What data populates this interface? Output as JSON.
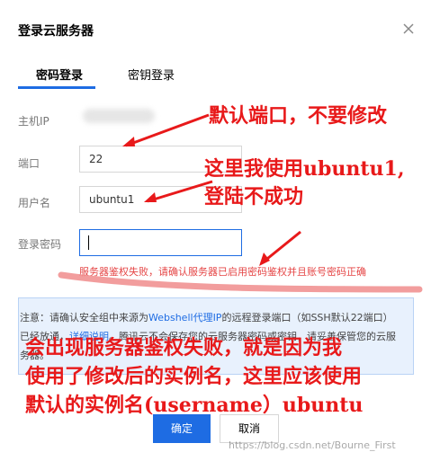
{
  "dialog": {
    "title": "登录云服务器"
  },
  "tabs": [
    {
      "label": "密码登录"
    },
    {
      "label": "密钥登录"
    }
  ],
  "form": {
    "host_label": "主机IP",
    "port_label": "端口",
    "port_value": "22",
    "user_label": "用户名",
    "user_value": "ubuntu1",
    "password_label": "登录密码",
    "password_value": ""
  },
  "error": "服务器鉴权失败，请确认服务器已启用密码鉴权并且账号密码正确",
  "notice": {
    "prefix": "注意：请确认安全组中来源为",
    "link1": "Webshell代理IP",
    "mid": "的远程登录端口（如SSH默认22端口）已经放通，",
    "link2": "详细说明",
    "suffix": "。腾讯云不会保存您的云服务器密码或密钥，请妥善保管您的云服务器。"
  },
  "buttons": {
    "ok": "确定",
    "cancel": "取消"
  },
  "watermark": "https://blog.csdn.net/Bourne_First",
  "annotations": {
    "a1": "默认端口，不要修改",
    "a2": "这里我使用ubuntu1,",
    "a3": "登陆不成功",
    "a4": "会出现服务器鉴权失败，就是因为我",
    "a5": "使用了修改后的实例名，这里应该使用",
    "a6": "默认的实例名(username）ubuntu"
  },
  "colors": {
    "accent": "#1e6ce3",
    "error": "#e54545",
    "annotation": "#e8191a"
  }
}
